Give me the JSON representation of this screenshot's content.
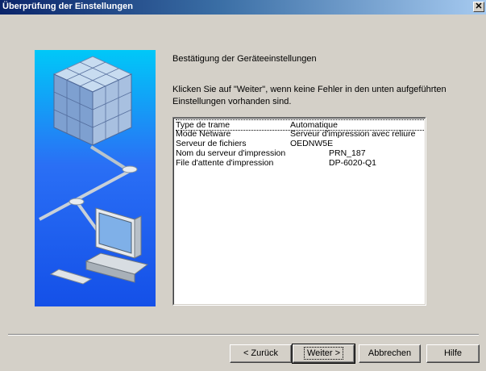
{
  "window": {
    "title": "Überprüfung der Einstellungen",
    "close_glyph": "✕"
  },
  "content": {
    "heading": "Bestätigung der Geräteeinstellungen",
    "description": "Klicken Sie auf \"Weiter\", wenn keine Fehler in den unten aufgeführten Einstellungen vorhanden sind."
  },
  "settings": [
    {
      "key": "Type de trame",
      "value": "Automatique"
    },
    {
      "key": "Mode Netware",
      "value": "Serveur d'impression avec reliure"
    },
    {
      "key": "Serveur de fichiers",
      "value": "OEDNW5E"
    },
    {
      "key": "Nom du serveur d'impression",
      "value": "PRN_187"
    },
    {
      "key": "File d'attente d'impression",
      "value": "DP-6020-Q1"
    }
  ],
  "buttons": {
    "back": "< Zurück",
    "next": "Weiter >",
    "cancel": "Abbrechen",
    "help": "Hilfe"
  },
  "colors": {
    "titlebar_start": "#0a246a",
    "titlebar_end": "#a6caf0",
    "dialog_bg": "#d4d0c8",
    "art_top": "#00c8f8",
    "art_bottom": "#1450e8"
  },
  "icons": [
    "cube-icon",
    "computer-icon",
    "network-cable-icon"
  ]
}
